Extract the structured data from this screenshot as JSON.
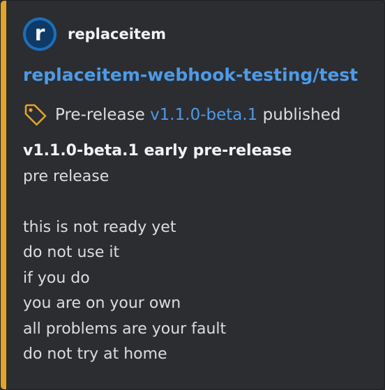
{
  "colors": {
    "accent_bar": "#e3a42a",
    "link": "#4d9be8",
    "background": "#2b2d31",
    "text": "#dbdee1",
    "tag_icon": "#e3a42a"
  },
  "author": {
    "avatar_letter": "r",
    "name": "replaceitem"
  },
  "title": "replaceitem-webhook-testing/test",
  "release": {
    "icon": "tag-icon",
    "prefix": "Pre-release",
    "version": "v1.1.0-beta.1",
    "suffix": "published"
  },
  "description": {
    "heading": "v1.1.0-beta.1 early pre-release",
    "intro": "pre release",
    "lines": [
      "this is not ready yet",
      "do not use it",
      "if you do",
      "you are on your own",
      "all problems are your fault",
      "do not try at home"
    ]
  }
}
